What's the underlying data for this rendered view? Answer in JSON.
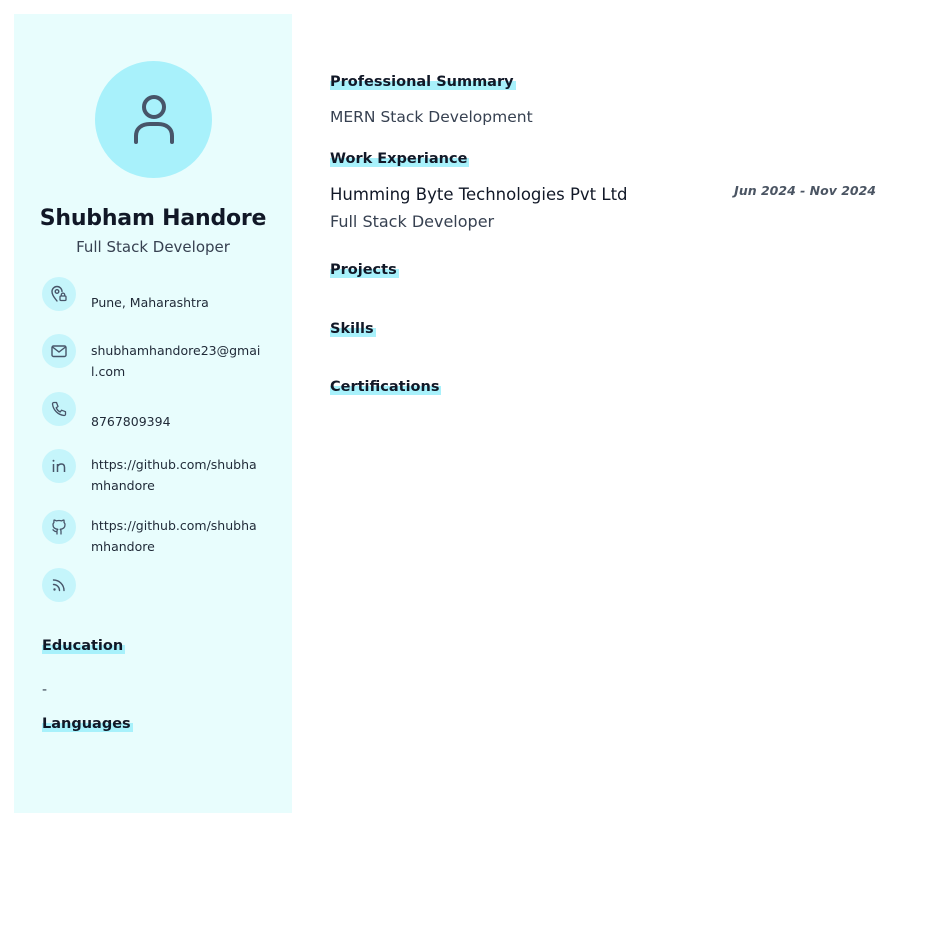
{
  "profile": {
    "name": "Shubham Handore",
    "title": "Full Stack Developer"
  },
  "contacts": [
    {
      "icon": "location-icon",
      "text": "Pune, Maharashtra"
    },
    {
      "icon": "mail-icon",
      "text": "shubhamhandore23@gmail.com"
    },
    {
      "icon": "phone-icon",
      "text": "8767809394"
    },
    {
      "icon": "linkedin-icon",
      "text": "https://github.com/shubhamhandore"
    },
    {
      "icon": "github-icon",
      "text": "https://github.com/shubhamhandore"
    },
    {
      "icon": "rss-icon",
      "text": ""
    }
  ],
  "sidebar_sections": {
    "education": {
      "heading": "Education",
      "content": "-"
    },
    "languages": {
      "heading": "Languages"
    }
  },
  "main": {
    "summary": {
      "heading": "Professional Summary",
      "text": "MERN Stack Development"
    },
    "experience": {
      "heading": "Work Experiance",
      "company": "Humming Byte Technologies Pvt Ltd",
      "role": "Full Stack Developer",
      "dates": "Jun 2024 - Nov 2024"
    },
    "projects": {
      "heading": "Projects"
    },
    "skills": {
      "heading": "Skills"
    },
    "certifications": {
      "heading": "Certifications"
    }
  },
  "colors": {
    "sidebar_bg": "#e8fdfd",
    "accent": "#a8f1fb",
    "icon_bg": "#c5f5fb",
    "icon_stroke": "#475569"
  }
}
